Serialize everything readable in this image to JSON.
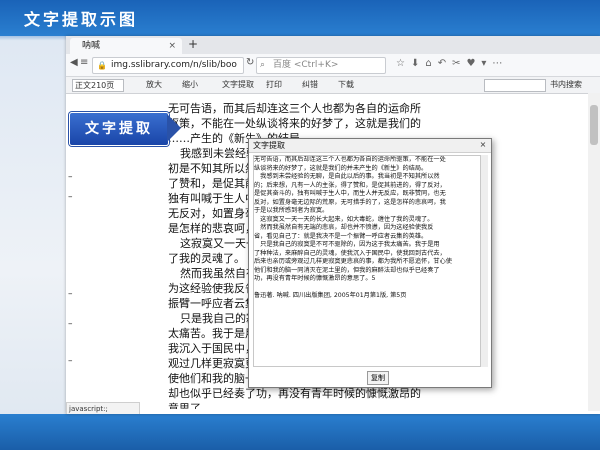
{
  "slide": {
    "title": "文字提取示图"
  },
  "browser": {
    "tab_title": "呐喊",
    "tab_close": "×",
    "new_tab": "+",
    "url": "img.sslibrary.com/n/slib/boo",
    "search_placeholder": "百度 <Ctrl+K>",
    "status_text": "javascript:;"
  },
  "reader_toolbar": {
    "zoom": "正文210页",
    "items": [
      "放大",
      "缩小",
      "文字提取",
      "打印",
      "纠错",
      "下载"
    ],
    "search_button": "书内搜索"
  },
  "page_lines": [
    "无可告语，而其后却连这三个人也都为各自的运命所",
    "驱策，不能在一处纵谈将来的好梦了，这就是我们的",
    "……产生的《新生》的结局。",
    "我感到未尝经验的无聊，是自此以后的事。我当",
    "初是不知其所以然的；后来想，凡有一人的主张，得",
    "了赞和，是促其前进的，得了反对，是促其奋斗的，",
    "独有叫喊于生人中，而生人并无反应，既非赞同，也",
    "无反对，如置身毫无边际的荒原，无可措手的了，这",
    "是怎样的悲哀呵，我于是以我所感到者为寂寞。",
    "这寂寞又一天一天的长大起来，如大毒蛇，缠住",
    "了我的灵魂了。",
    "然而我虽然自有无端的悲哀，却也并不愤懑，因",
    "为这经验使我反省，看见自己了：就是我决不是一个",
    "振臂一呼应者云集的英雄。",
    "只是我自己的寂寞是不可不驱除的，因为这于我",
    "太痛苦。我于是用了种种法，来麻醉自己的灵魂，使",
    "我沉入于国民中，使我回到古代去，后来也亲历或旁",
    "观过几样更寂寞更悲哀的事，都为我所不愿追怀，甘",
    "使他们和我的脑一同消灭在泥土里的，但我的麻醉法",
    "却也似乎已经奏了功，再没有青年时候的慷慨激昂的",
    "意思了。"
  ],
  "callout": {
    "label": "文字提取"
  },
  "dialog": {
    "title": "文字提取",
    "close": "×",
    "copy_button": "复制",
    "text_lines": [
      "无可告语，而其后却连这三个人也都为各自的运命所驱策，不能在一处",
      "纵谈将来的好梦了，这就是我们的并未产生的《新生》的结局。",
      "　我感到未尝经验的无聊，是自此以后的事。我当初是不知其所以然",
      "的；后来想，凡有一人的主张，得了赞和，是促其前进的，得了反对，",
      "是促其奋斗的，独有叫喊于生人中，而生人并无反应，既非赞同，也无",
      "反对，如置身毫无边际的荒原，无可措手的了，这是怎样的悲哀呵，我",
      "于是以我所感到者为寂寞。",
      "　这寂寞又一天一天的长大起来，如大毒蛇，缠住了我的灵魂了。",
      "　然而我虽然自有无端的悲哀，却也并不愤懑，因为这经验使我反",
      "省，看见自己了：就是我决不是一个振臂一呼应者云集的英雄。",
      "　只是我自己的寂寞是不可不驱除的，因为这于我太痛苦。我于是用",
      "了种种法，来麻醉自己的灵魂，使我沉入于国民中，使我回到古代去，",
      "后来也亲历或旁观过几样更寂寞更悲哀的事，都为我所不愿追怀，甘心使",
      "他们和我的脑一同消灭在泥土里的，但我的麻醉法却也似乎已经奏了",
      "功，再没有青年时候的慷慨激昂的意思了。5",
      "",
      "鲁迅著. 呐喊. 四川出版集团, 2005年01月第1版, 第5页"
    ]
  },
  "icons": {
    "back": "back-arrow-icon",
    "lock": "lock-icon",
    "search": "search-icon"
  }
}
